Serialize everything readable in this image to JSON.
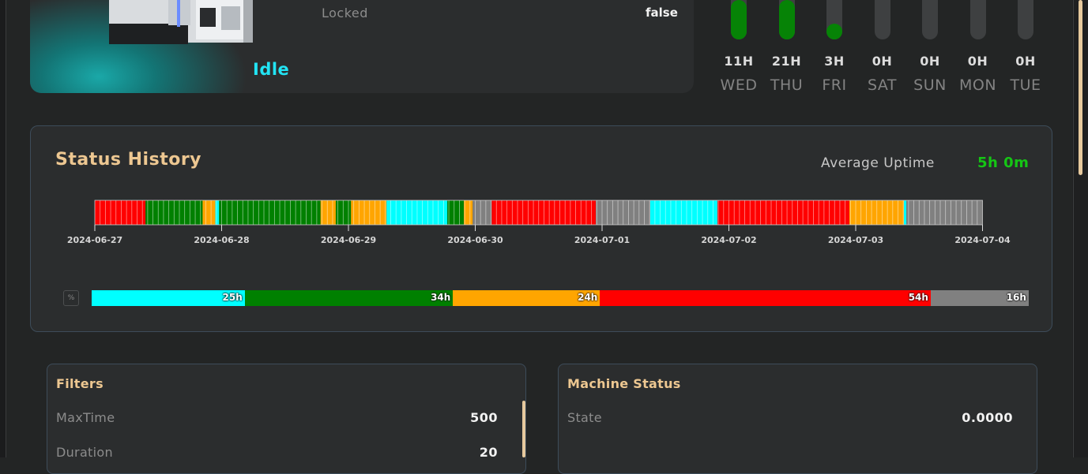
{
  "machine": {
    "state_label": "Idle",
    "locked_label": "Locked",
    "locked_value": "false"
  },
  "weekly": [
    {
      "hours": "11H",
      "day": "WED",
      "fill": 1.0
    },
    {
      "hours": "21H",
      "day": "THU",
      "fill": 1.0
    },
    {
      "hours": "3H",
      "day": "FRI",
      "fill": 0.4
    },
    {
      "hours": "0H",
      "day": "SAT",
      "fill": 0
    },
    {
      "hours": "0H",
      "day": "SUN",
      "fill": 0
    },
    {
      "hours": "0H",
      "day": "MON",
      "fill": 0
    },
    {
      "hours": "0H",
      "day": "TUE",
      "fill": 0
    }
  ],
  "history": {
    "title": "Status History",
    "avg_label": "Average Uptime",
    "avg_value": "5h 0m",
    "percent_toggle": "%",
    "dates": [
      "2024-06-27",
      "2024-06-28",
      "2024-06-29",
      "2024-06-30",
      "2024-07-01",
      "2024-07-02",
      "2024-07-03",
      "2024-07-04"
    ],
    "colors": {
      "idle": "#00ffff",
      "running": "#008000",
      "warning": "#ffa500",
      "alarm": "#ff0000",
      "offline": "#808080"
    },
    "segments": [
      {
        "state": "alarm",
        "from": 0.0,
        "to": 0.4
      },
      {
        "state": "running",
        "from": 0.4,
        "to": 0.85
      },
      {
        "state": "warning",
        "from": 0.85,
        "to": 0.95
      },
      {
        "state": "idle",
        "from": 0.95,
        "to": 0.98
      },
      {
        "state": "running",
        "from": 0.98,
        "to": 1.78
      },
      {
        "state": "warning",
        "from": 1.78,
        "to": 1.9
      },
      {
        "state": "running",
        "from": 1.9,
        "to": 2.02
      },
      {
        "state": "warning",
        "from": 2.02,
        "to": 2.3
      },
      {
        "state": "idle",
        "from": 2.3,
        "to": 2.78
      },
      {
        "state": "running",
        "from": 2.78,
        "to": 2.91
      },
      {
        "state": "warning",
        "from": 2.91,
        "to": 2.98
      },
      {
        "state": "offline",
        "from": 2.98,
        "to": 3.13
      },
      {
        "state": "alarm",
        "from": 3.13,
        "to": 3.95
      },
      {
        "state": "offline",
        "from": 3.95,
        "to": 4.38
      },
      {
        "state": "idle",
        "from": 4.38,
        "to": 4.91
      },
      {
        "state": "alarm",
        "from": 4.91,
        "to": 5.95
      },
      {
        "state": "warning",
        "from": 5.95,
        "to": 6.38
      },
      {
        "state": "idle",
        "from": 6.38,
        "to": 6.4
      },
      {
        "state": "offline",
        "from": 6.4,
        "to": 7.0
      }
    ],
    "summary": [
      {
        "state": "idle",
        "hours": 25,
        "label": "25h"
      },
      {
        "state": "running",
        "hours": 34,
        "label": "34h"
      },
      {
        "state": "warning",
        "hours": 24,
        "label": "24h"
      },
      {
        "state": "alarm",
        "hours": 54,
        "label": "54h"
      },
      {
        "state": "offline",
        "hours": 16,
        "label": "16h"
      }
    ]
  },
  "filters": {
    "title": "Filters",
    "rows": [
      {
        "label": "MaxTime",
        "value": "500"
      },
      {
        "label": "Duration",
        "value": "20"
      }
    ]
  },
  "machine_status": {
    "title": "Machine Status",
    "rows": [
      {
        "label": "State",
        "value": "0.0000"
      }
    ]
  }
}
